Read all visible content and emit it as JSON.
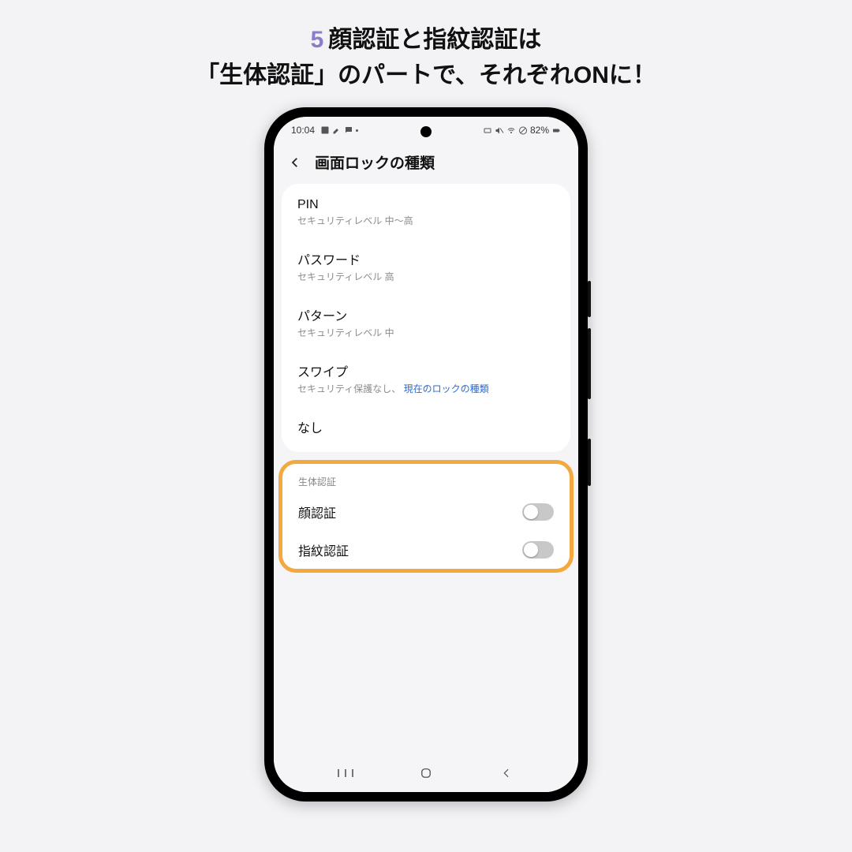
{
  "caption": {
    "step": "5",
    "line1": "顔認証と指紋認証は",
    "line2": "「生体認証」のパートで、それぞれONに！"
  },
  "status": {
    "time": "10:04",
    "battery": "82%"
  },
  "header": {
    "title": "画面ロックの種類"
  },
  "lock_types": [
    {
      "title": "PIN",
      "sub": "セキュリティレベル 中～高"
    },
    {
      "title": "パスワード",
      "sub": "セキュリティレベル 高"
    },
    {
      "title": "パターン",
      "sub": "セキュリティレベル 中"
    },
    {
      "title": "スワイプ",
      "sub_prefix": "セキュリティ保護なし、 ",
      "sub_highlight": "現在のロックの種類"
    },
    {
      "title": "なし",
      "sub": ""
    }
  ],
  "biometrics": {
    "section_label": "生体認証",
    "items": [
      {
        "title": "顔認証"
      },
      {
        "title": "指紋認証"
      }
    ]
  }
}
